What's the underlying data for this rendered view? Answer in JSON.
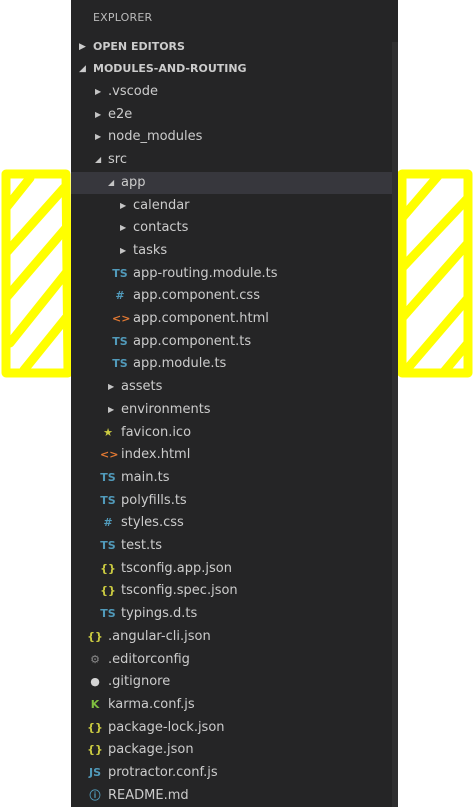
{
  "explorer": {
    "title": "EXPLORER",
    "sections": [
      {
        "label": "OPEN EDITORS",
        "expanded": false
      },
      {
        "label": "MODULES-AND-ROUTING",
        "expanded": true
      }
    ]
  },
  "tree": [
    {
      "label": ".vscode",
      "kind": "folder",
      "depth": 0,
      "expanded": false
    },
    {
      "label": "e2e",
      "kind": "folder",
      "depth": 0,
      "expanded": false
    },
    {
      "label": "node_modules",
      "kind": "folder",
      "depth": 0,
      "expanded": false
    },
    {
      "label": "src",
      "kind": "folder",
      "depth": 0,
      "expanded": true
    },
    {
      "label": "app",
      "kind": "folder",
      "depth": 1,
      "expanded": true,
      "selected": true
    },
    {
      "label": "calendar",
      "kind": "folder",
      "depth": 2,
      "expanded": false
    },
    {
      "label": "contacts",
      "kind": "folder",
      "depth": 2,
      "expanded": false
    },
    {
      "label": "tasks",
      "kind": "folder",
      "depth": 2,
      "expanded": false
    },
    {
      "label": "app-routing.module.ts",
      "kind": "file",
      "depth": 2,
      "icon": "typescript-icon",
      "glyph": "TS",
      "color": "#519aba"
    },
    {
      "label": "app.component.css",
      "kind": "file",
      "depth": 2,
      "icon": "css-icon",
      "glyph": "#",
      "color": "#519aba"
    },
    {
      "label": "app.component.html",
      "kind": "file",
      "depth": 2,
      "icon": "html-icon",
      "glyph": "<>",
      "color": "#e37933"
    },
    {
      "label": "app.component.ts",
      "kind": "file",
      "depth": 2,
      "icon": "typescript-icon",
      "glyph": "TS",
      "color": "#519aba"
    },
    {
      "label": "app.module.ts",
      "kind": "file",
      "depth": 2,
      "icon": "typescript-icon",
      "glyph": "TS",
      "color": "#519aba"
    },
    {
      "label": "assets",
      "kind": "folder",
      "depth": 1,
      "expanded": false
    },
    {
      "label": "environments",
      "kind": "folder",
      "depth": 1,
      "expanded": false
    },
    {
      "label": "favicon.ico",
      "kind": "file",
      "depth": 1,
      "icon": "star-icon",
      "glyph": "★",
      "color": "#cbcb41"
    },
    {
      "label": "index.html",
      "kind": "file",
      "depth": 1,
      "icon": "html-icon",
      "glyph": "<>",
      "color": "#e37933"
    },
    {
      "label": "main.ts",
      "kind": "file",
      "depth": 1,
      "icon": "typescript-icon",
      "glyph": "TS",
      "color": "#519aba"
    },
    {
      "label": "polyfills.ts",
      "kind": "file",
      "depth": 1,
      "icon": "typescript-icon",
      "glyph": "TS",
      "color": "#519aba"
    },
    {
      "label": "styles.css",
      "kind": "file",
      "depth": 1,
      "icon": "css-icon",
      "glyph": "#",
      "color": "#519aba"
    },
    {
      "label": "test.ts",
      "kind": "file",
      "depth": 1,
      "icon": "typescript-icon",
      "glyph": "TS",
      "color": "#519aba"
    },
    {
      "label": "tsconfig.app.json",
      "kind": "file",
      "depth": 1,
      "icon": "json-icon",
      "glyph": "{}",
      "color": "#cbcb41"
    },
    {
      "label": "tsconfig.spec.json",
      "kind": "file",
      "depth": 1,
      "icon": "json-icon",
      "glyph": "{}",
      "color": "#cbcb41"
    },
    {
      "label": "typings.d.ts",
      "kind": "file",
      "depth": 1,
      "icon": "typescript-icon",
      "glyph": "TS",
      "color": "#519aba"
    },
    {
      "label": ".angular-cli.json",
      "kind": "file",
      "depth": 0,
      "icon": "json-icon",
      "glyph": "{}",
      "color": "#cbcb41"
    },
    {
      "label": ".editorconfig",
      "kind": "file",
      "depth": 0,
      "icon": "gear-icon",
      "glyph": "⚙",
      "color": "#8a8a8a"
    },
    {
      "label": ".gitignore",
      "kind": "file",
      "depth": 0,
      "icon": "github-icon",
      "glyph": "●",
      "color": "#d4d4d4"
    },
    {
      "label": "karma.conf.js",
      "kind": "file",
      "depth": 0,
      "icon": "karma-icon",
      "glyph": "K",
      "color": "#7fbf3f"
    },
    {
      "label": "package-lock.json",
      "kind": "file",
      "depth": 0,
      "icon": "json-icon",
      "glyph": "{}",
      "color": "#cbcb41"
    },
    {
      "label": "package.json",
      "kind": "file",
      "depth": 0,
      "icon": "json-icon",
      "glyph": "{}",
      "color": "#cbcb41"
    },
    {
      "label": "protractor.conf.js",
      "kind": "file",
      "depth": 0,
      "icon": "javascript-icon",
      "glyph": "JS",
      "color": "#519aba"
    },
    {
      "label": "README.md",
      "kind": "file",
      "depth": 0,
      "icon": "info-icon",
      "glyph": "ⓘ",
      "color": "#519aba"
    }
  ],
  "theme": {
    "panel_bg": "#252526",
    "selection_bg": "#37373d",
    "annotation_color": "#ffff00"
  }
}
